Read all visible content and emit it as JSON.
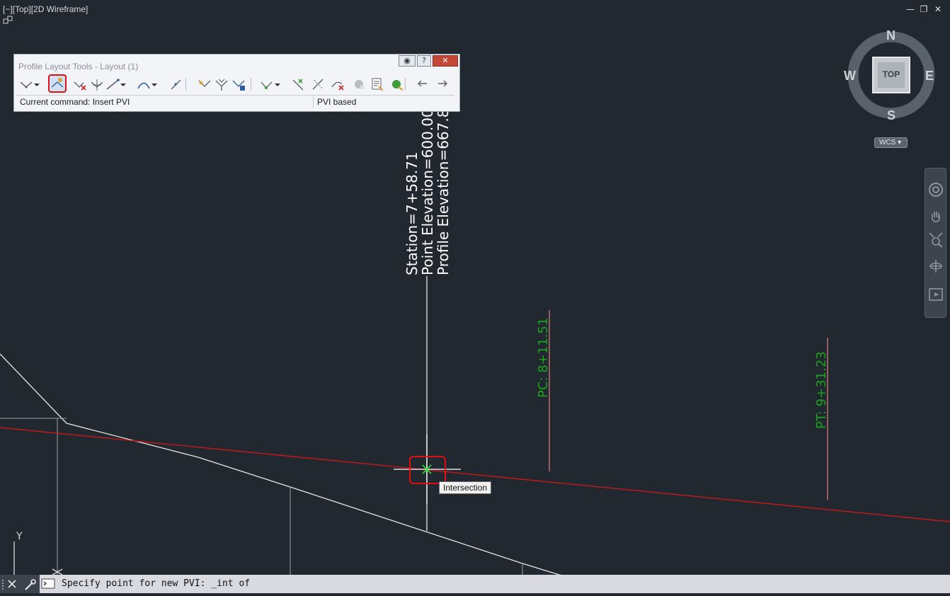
{
  "viewport": {
    "label": "[−][Top][2D Wireframe]",
    "window_controls": {
      "minimize": "—",
      "restore": "❐",
      "close": "✕"
    }
  },
  "palette": {
    "title": "Profile Layout Tools - Layout (1)",
    "status_command": "Current command: Insert PVI",
    "status_mode": "PVI based",
    "header_help": "?",
    "header_close": "✕",
    "tools": [
      {
        "icon": "pvi-tangent-icon",
        "dropdown": true
      },
      {
        "icon": "insert-pvi-icon",
        "selected": true
      },
      {
        "icon": "delete-pvi-icon"
      },
      {
        "icon": "move-pvi-icon"
      },
      {
        "icon": "draw-tangent-icon",
        "dropdown": true
      },
      {
        "icon": "curve-icon",
        "dropdown": true
      },
      {
        "icon": "convert-icon"
      },
      {
        "icon": "insert-pvis-tabular-icon"
      },
      {
        "icon": "delete-pvis-icon"
      },
      {
        "icon": "raise-lower-pvis-icon"
      },
      {
        "icon": "select-pvi-icon",
        "dropdown": true
      },
      {
        "icon": "delete-entity-icon"
      },
      {
        "icon": "edit-best-fit-icon"
      },
      {
        "icon": "delete-curve-icon"
      },
      {
        "icon": "sub-entity-icon"
      },
      {
        "icon": "grid-view-icon"
      },
      {
        "icon": "profile-check-icon"
      },
      {
        "icon": "undo-icon"
      },
      {
        "icon": "redo-icon"
      }
    ]
  },
  "drawing": {
    "pvi_label_station": "Station=7+58.71",
    "pvi_label_point_elev": "Point Elevation=600.00",
    "pvi_label_profile_elev": "Profile Elevation=667.8",
    "pc_label": "PC:  8+11.51",
    "pt_label": "PT:  9+31.23",
    "ucs_y": "Y",
    "colors": {
      "profile_red": "#c8181c",
      "label_green": "#1aa51a",
      "line_white": "#e6e6e6"
    }
  },
  "viewcube": {
    "n": "N",
    "s": "S",
    "e": "E",
    "w": "W",
    "face": "TOP",
    "wcs": "WCS"
  },
  "tooltip": "Intersection",
  "command_line": {
    "prompt": "Specify point for new PVI: _int of"
  }
}
